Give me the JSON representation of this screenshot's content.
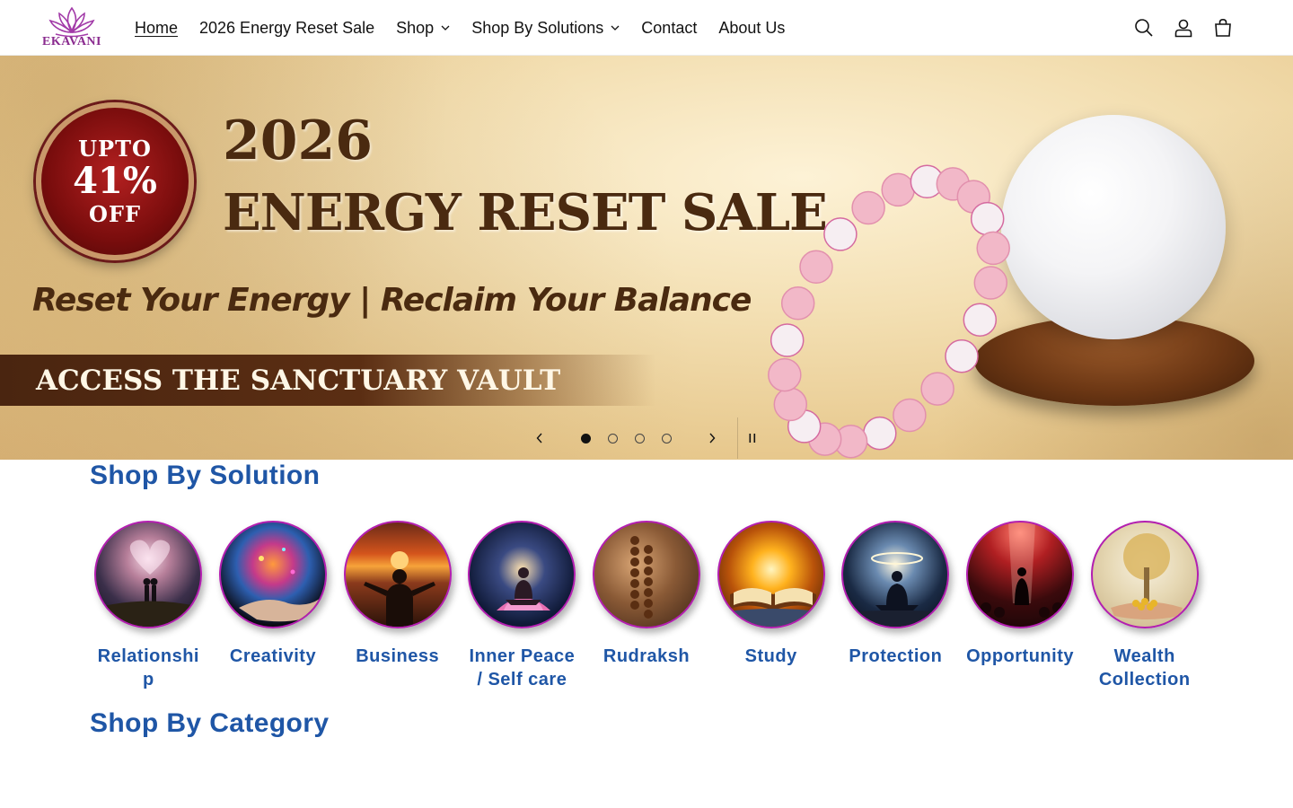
{
  "brand": {
    "logo_text": "EKAVANI"
  },
  "nav": {
    "items": [
      {
        "label": "Home",
        "active": true,
        "dropdown": false
      },
      {
        "label": "2026 Energy Reset Sale",
        "active": false,
        "dropdown": false
      },
      {
        "label": "Shop",
        "active": false,
        "dropdown": true
      },
      {
        "label": "Shop By Solutions",
        "active": false,
        "dropdown": true
      },
      {
        "label": "Contact",
        "active": false,
        "dropdown": false
      },
      {
        "label": "About Us",
        "active": false,
        "dropdown": false
      }
    ]
  },
  "header_icons": [
    "search-icon",
    "account-icon",
    "cart-icon"
  ],
  "hero": {
    "badge_line1": "UPTO",
    "badge_line2": "41%",
    "badge_line3": "OFF",
    "year": "2026",
    "title": "ENERGY RESET SALE",
    "tagline": "Reset Your Energy | Reclaim Your Balance",
    "cta": "ACCESS THE SANCTUARY VAULT",
    "slide_count": 4,
    "active_slide": 1
  },
  "sections": {
    "solutions_title": "Shop By Solution",
    "category_title": "Shop By Category"
  },
  "solutions": [
    {
      "label": "Relationship",
      "theme": "couple-heart"
    },
    {
      "label": "Creativity",
      "theme": "cosmic-hand"
    },
    {
      "label": "Business",
      "theme": "sunset-city"
    },
    {
      "label": "Inner Peace / Self care",
      "theme": "lotus-meditation"
    },
    {
      "label": "Rudraksh",
      "theme": "mala-beads"
    },
    {
      "label": "Study",
      "theme": "glowing-book"
    },
    {
      "label": "Protection",
      "theme": "halo-meditation"
    },
    {
      "label": "Opportunity",
      "theme": "spotlight-crowd"
    },
    {
      "label": "Wealth Collection",
      "theme": "golden-tree"
    }
  ],
  "colors": {
    "accent_blue": "#1f56a6",
    "ring_magenta": "#b31fb0",
    "hero_brown": "#4a2a10",
    "logo_purple": "#8a2b8f"
  }
}
